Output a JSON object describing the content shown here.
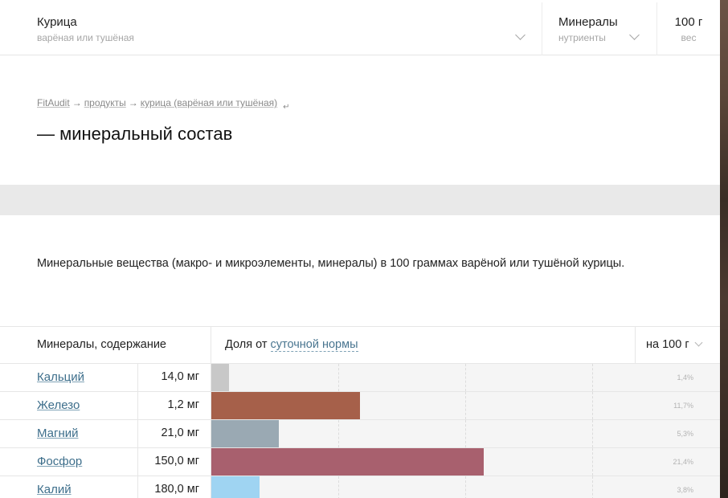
{
  "header": {
    "food": {
      "title": "Курица",
      "subtitle": "варёная или тушёная"
    },
    "nutrients": {
      "title": "Минералы",
      "subtitle": "нутриенты"
    },
    "weight": {
      "title": "100 г",
      "subtitle": "вес"
    }
  },
  "breadcrumb": {
    "items": [
      "FitAudit",
      "продукты",
      "курица (варёная или тушёная)"
    ],
    "separator": "→",
    "back_glyph": "↵"
  },
  "page_title": "— минеральный состав",
  "intro": "Минеральные вещества (макро- и микроэлементы, минералы) в 100 граммах варёной или тушёной курицы.",
  "table": {
    "col_name": "Минералы, содержание",
    "col_norm_prefix": "Доля от",
    "col_norm_link": "суточной нормы",
    "col_per": "на 100 г",
    "scale_max_percent": 40,
    "rows": [
      {
        "name": "Кальций",
        "amount": "14,0 мг",
        "percent_label": "1,4%",
        "percent": 1.4,
        "color": "#c8c8c8"
      },
      {
        "name": "Железо",
        "amount": "1,2 мг",
        "percent_label": "11,7%",
        "percent": 11.7,
        "color": "#a6604a"
      },
      {
        "name": "Магний",
        "amount": "21,0 мг",
        "percent_label": "5,3%",
        "percent": 5.3,
        "color": "#9aa9b3"
      },
      {
        "name": "Фосфор",
        "amount": "150,0 мг",
        "percent_label": "21,4%",
        "percent": 21.4,
        "color": "#a8606e"
      },
      {
        "name": "Калий",
        "amount": "180,0 мг",
        "percent_label": "3,8%",
        "percent": 3.8,
        "color": "#9fd4f2"
      }
    ]
  }
}
